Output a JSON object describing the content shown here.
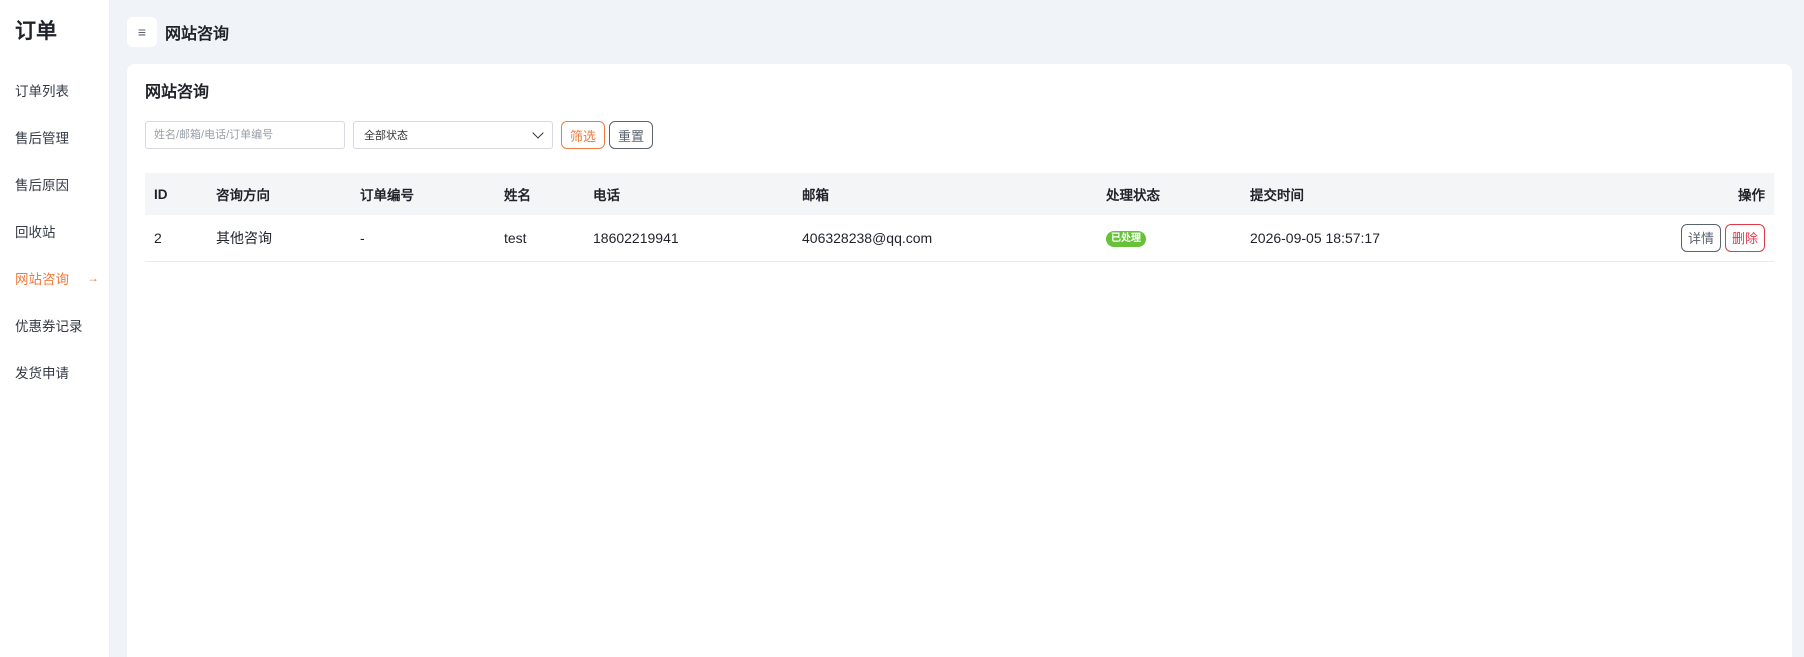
{
  "sidebar": {
    "title": "订单",
    "items": [
      {
        "label": "订单列表",
        "active": false
      },
      {
        "label": "售后管理",
        "active": false
      },
      {
        "label": "售后原因",
        "active": false
      },
      {
        "label": "回收站",
        "active": false
      },
      {
        "label": "网站咨询",
        "active": true
      },
      {
        "label": "优惠券记录",
        "active": false
      },
      {
        "label": "发货申请",
        "active": false
      }
    ],
    "active_arrow": "→"
  },
  "topbar": {
    "menu_icon": "≡",
    "title": "网站咨询"
  },
  "card": {
    "title": "网站咨询",
    "filters": {
      "search_placeholder": "姓名/邮箱/电话/订单编号",
      "search_value": "",
      "status_selected": "全部状态",
      "filter_label": "筛选",
      "reset_label": "重置"
    },
    "table": {
      "headers": {
        "id": "ID",
        "direction": "咨询方向",
        "order_no": "订单编号",
        "name": "姓名",
        "phone": "电话",
        "email": "邮箱",
        "status": "处理状态",
        "submit_time": "提交时间",
        "ops": "操作"
      },
      "rows": [
        {
          "id": "2",
          "direction": "其他咨询",
          "order_no": "-",
          "name": "test",
          "phone": "18602219941",
          "email": "406328238@qq.com",
          "status": "已处理",
          "submit_time": "2026-09-05 18:57:17",
          "detail_label": "详情",
          "delete_label": "删除"
        }
      ]
    }
  },
  "colors": {
    "accent": "#f07b3f",
    "status_done": "#67c23a",
    "danger": "#e0394a"
  }
}
